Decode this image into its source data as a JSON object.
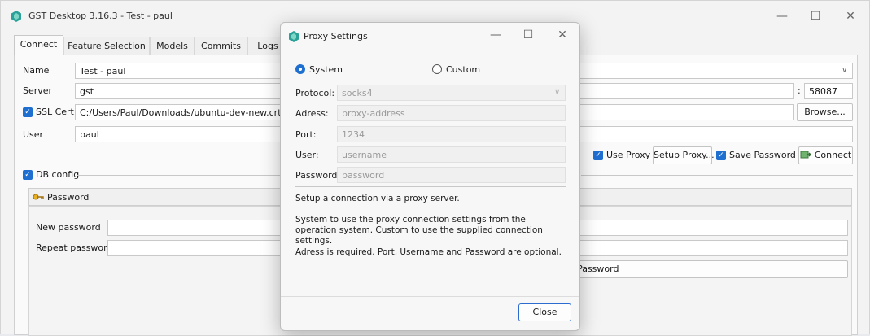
{
  "window": {
    "title": "GST Desktop 3.16.3 - Test - paul",
    "min": "—",
    "max": "☐",
    "close": "✕"
  },
  "tabs": [
    "Connect",
    "Feature Selection",
    "Models",
    "Commits",
    "Logs"
  ],
  "connect": {
    "name_label": "Name",
    "name_value": "Test - paul",
    "server_label": "Server",
    "server_value": "gst",
    "port_sep": ":",
    "port_value": "58087",
    "sslcert_label": "SSL Cert",
    "sslcert_value": "C:/Users/Paul/Downloads/ubuntu-dev-new.crt",
    "browse_label": "Browse...",
    "user_label": "User",
    "user_value": "paul",
    "use_proxy_label": "Use Proxy",
    "setup_proxy_label": "Setup Proxy...",
    "save_password_label": "Save Password",
    "connect_label": "Connect"
  },
  "db_config": {
    "label": "DB config",
    "password_section": "Password",
    "new_password_label": "New password",
    "repeat_password_label": "Repeat password",
    "set_password_label": "Set Password"
  },
  "dialog": {
    "title": "Proxy Settings",
    "min": "—",
    "max": "☐",
    "close": "✕",
    "radio_system": "System",
    "radio_custom": "Custom",
    "protocol_label": "Protocol:",
    "protocol_value": "socks4",
    "address_label": "Adress:",
    "address_placeholder": "proxy-address",
    "port_label": "Port:",
    "port_value": "1234",
    "user_label": "User:",
    "user_placeholder": "username",
    "password_label": "Password:",
    "password_placeholder": "password",
    "info1": "Setup a connection via a proxy server.",
    "info2": "System to use the proxy connection settings from the operation system. Custom to use the supplied connection settings.",
    "info3": "Adress is required. Port, Username and Password are optional.",
    "close_label": "Close"
  },
  "colors": {
    "accent": "#1f6fd1",
    "logo": "#2aa198"
  },
  "icons": {
    "app": "gst-logo-icon",
    "key": "key-icon",
    "connect": "connect-icon"
  }
}
